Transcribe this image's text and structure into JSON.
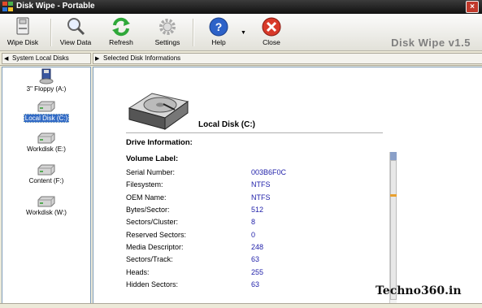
{
  "window": {
    "title": "Disk Wipe - Portable",
    "close_label": "×"
  },
  "toolbar": {
    "buttons": [
      {
        "label": "Wipe Disk",
        "icon": "wipe-disk-icon"
      },
      {
        "label": "View Data",
        "icon": "magnifier-icon"
      },
      {
        "label": "Refresh",
        "icon": "refresh-icon"
      },
      {
        "label": "Settings",
        "icon": "gear-icon"
      },
      {
        "label": "Help",
        "icon": "help-icon"
      },
      {
        "label": "Close",
        "icon": "close-icon"
      }
    ],
    "help_dropdown": "▼",
    "brand": "Disk Wipe v1.5"
  },
  "left_panel": {
    "header": "System Local Disks",
    "drives": [
      {
        "label": "3\" Floppy (A:)",
        "icon": "floppy-icon",
        "selected": false
      },
      {
        "label": "Local Disk (C:)",
        "icon": "hard-drive-icon",
        "selected": true
      },
      {
        "label": "Workdisk (E:)",
        "icon": "hard-drive-icon",
        "selected": false
      },
      {
        "label": "Content (F:)",
        "icon": "hard-drive-icon",
        "selected": false
      },
      {
        "label": "Workdisk (W:)",
        "icon": "hard-drive-icon",
        "selected": false
      }
    ]
  },
  "right_panel": {
    "header": "Selected Disk Informations",
    "disk_name": "Local Disk  (C:)",
    "drive_info_heading": "Drive Information:",
    "volume_label_heading": "Volume Label:",
    "rows": [
      {
        "key": "Serial Number:",
        "value": "003B6F0C"
      },
      {
        "key": "Filesystem:",
        "value": "NTFS"
      },
      {
        "key": "OEM Name:",
        "value": "NTFS"
      },
      {
        "key": "Bytes/Sector:",
        "value": "512"
      },
      {
        "key": "Sectors/Cluster:",
        "value": "8"
      },
      {
        "key": "Reserved Sectors:",
        "value": "0"
      },
      {
        "key": "Media Descriptor:",
        "value": "248"
      },
      {
        "key": "Sectors/Track:",
        "value": "63"
      },
      {
        "key": "Heads:",
        "value": "255"
      },
      {
        "key": "Hidden Sectors:",
        "value": "63"
      }
    ]
  },
  "watermark": "Techno360.in"
}
